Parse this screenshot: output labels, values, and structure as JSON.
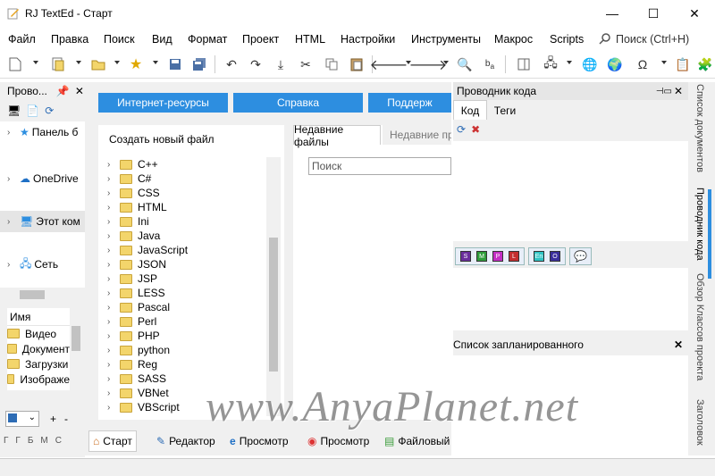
{
  "window": {
    "title": "RJ TextEd - Старт",
    "minimize": "—",
    "maximize": "☐",
    "close": "✕"
  },
  "menu": [
    "Файл",
    "Правка",
    "Поиск",
    "Вид",
    "Формат",
    "Проект",
    "HTML",
    "Настройки",
    "Инструменты",
    "Макрос",
    "Scripts"
  ],
  "search": {
    "placeholder": "Поиск (Ctrl+H)"
  },
  "left": {
    "title": "Прово...",
    "tree": [
      "Панель б",
      "OneDrive",
      "Этот ком",
      "Сеть"
    ],
    "list_header": "Имя",
    "files": [
      "Видео",
      "Документ",
      "Загрузки",
      "Изображе"
    ],
    "plus": "+",
    "minus": "-",
    "bottom_tabs": [
      "Г",
      "Г",
      "Б",
      "М",
      "С"
    ]
  },
  "center": {
    "buttons": [
      "Интернет-ресурсы",
      "Справка",
      "Поддерж"
    ],
    "new_file_label": "Создать новый файл",
    "languages": [
      "C++",
      "C#",
      "CSS",
      "HTML",
      "Ini",
      "Java",
      "JavaScript",
      "JSON",
      "JSP",
      "LESS",
      "Pascal",
      "Perl",
      "PHP",
      "python",
      "Reg",
      "SASS",
      "VBNet",
      "VBScript"
    ],
    "tabs": [
      "Недавние файлы",
      "Недавние пр"
    ],
    "search_placeholder": "Поиск",
    "bottom_tabs": [
      "Старт",
      "Редактор",
      "Просмотр",
      "Просмотр",
      "Файловый"
    ]
  },
  "right": {
    "title": "Проводник кода",
    "tabs": [
      "Код",
      "Теги"
    ],
    "badges": [
      "S",
      "M",
      "P",
      "L",
      "En",
      "O"
    ],
    "scheduled_title": "Список запланированного",
    "side_tabs": [
      "Список документов",
      "Проводник кода",
      "Обзор Классов проекта",
      "Заголовок"
    ]
  },
  "watermark": "www.AnyaPlanet.net"
}
